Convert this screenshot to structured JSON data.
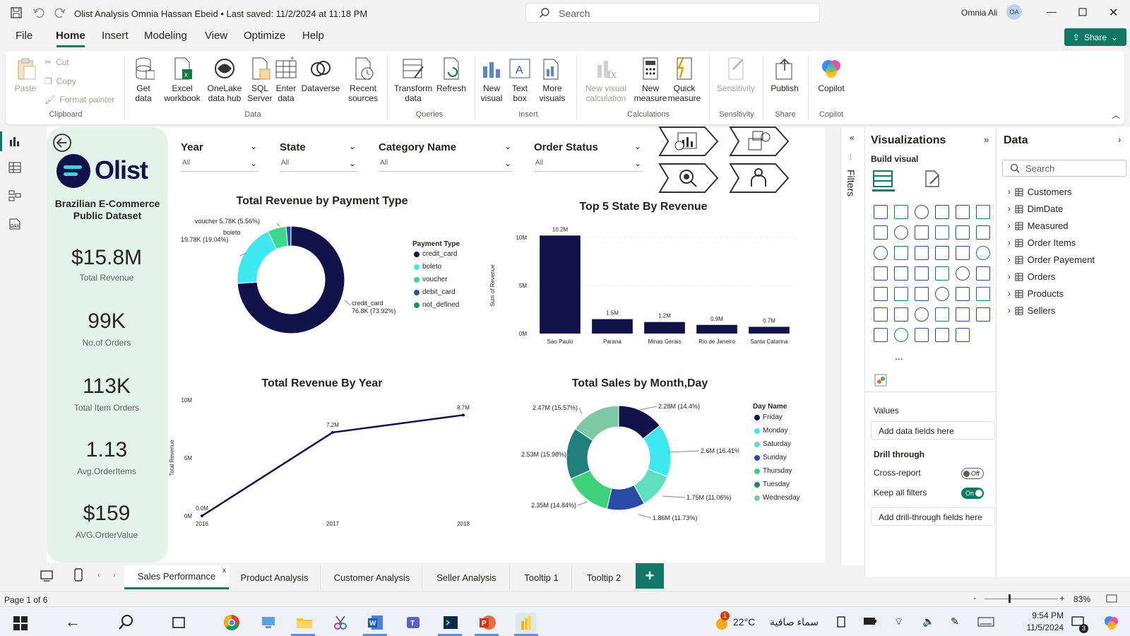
{
  "window": {
    "title": "Olist Analysis Omnia Hassan Ebeid • Last saved: 11/2/2024 at 11:18 PM",
    "search_placeholder": "Search",
    "user_name": "Omnia Ali",
    "user_initials": "OA"
  },
  "menu": [
    "File",
    "Home",
    "Insert",
    "Modeling",
    "View",
    "Optimize",
    "Help"
  ],
  "share_label": "Share",
  "ribbon": {
    "clipboard": {
      "paste": "Paste",
      "cut": "Cut",
      "copy": "Copy",
      "format_painter": "Format painter",
      "group": "Clipboard"
    },
    "data": {
      "get_data": "Get data",
      "excel": "Excel workbook",
      "onelake": "OneLake data hub",
      "sql": "SQL Server",
      "enter": "Enter data",
      "dataverse": "Dataverse",
      "recent": "Recent sources",
      "group": "Data"
    },
    "queries": {
      "transform": "Transform data",
      "refresh": "Refresh",
      "group": "Queries"
    },
    "insert": {
      "new_visual": "New visual",
      "text_box": "Text box",
      "more_visuals": "More visuals",
      "group": "Insert"
    },
    "calculations": {
      "new_visual_calc": "New visual calculation",
      "new_measure": "New measure",
      "quick_measure": "Quick measure",
      "group": "Calculations"
    },
    "sensitivity": {
      "label": "Sensitivity",
      "group": "Sensitivity"
    },
    "share": {
      "publish": "Publish",
      "group": "Share"
    },
    "copilot": {
      "label": "Copilot",
      "group": "Copilot"
    }
  },
  "report": {
    "brand": "Olist",
    "subtitle": "Brazilian E-Commerce Public Dataset",
    "kpis": [
      {
        "value": "$15.8M",
        "label": "Total Revenue"
      },
      {
        "value": "99K",
        "label": "No.of Orders"
      },
      {
        "value": "113K",
        "label": "Total Item Orders"
      },
      {
        "value": "1.13",
        "label": "Avg.OrderItems"
      },
      {
        "value": "$159",
        "label": "AVG.OrderValue"
      }
    ],
    "slicers": [
      {
        "title": "Year",
        "value": "All"
      },
      {
        "title": "State",
        "value": "All"
      },
      {
        "title": "Category Name",
        "value": "All"
      },
      {
        "title": "Order Status",
        "value": "All"
      }
    ]
  },
  "chart_data": [
    {
      "type": "pie",
      "title": "Total Revenue by Payment Type",
      "legend_title": "Payment Type",
      "categories": [
        "credit_card",
        "boleto",
        "voucher",
        "debit_card",
        "not_defined"
      ],
      "values": [
        73.92,
        19.04,
        5.56,
        1.45,
        0.03
      ],
      "labels": [
        "credit_card\n76.8K (73.92%)",
        "boleto\n19.78K (19.04%)",
        "voucher 5.78K (5.56%)",
        "",
        ""
      ],
      "colors": [
        "#12124a",
        "#3de8f0",
        "#3bd88a",
        "#2d4fa8",
        "#1f8a6a"
      ]
    },
    {
      "type": "bar",
      "title": "Top 5 State By Revenue",
      "ylabel": "Sum of Revenue",
      "categories": [
        "Sao Paulo",
        "Parana",
        "Minas Gerais",
        "Rio de Janeiro",
        "Santa Catarina"
      ],
      "values": [
        10.2,
        1.5,
        1.2,
        0.9,
        0.7
      ],
      "data_labels": [
        "10.2M",
        "1.5M",
        "1.2M",
        "0.9M",
        "0.7M"
      ],
      "ylim": [
        0,
        10
      ],
      "yticks": [
        "0M",
        "5M",
        "10M"
      ]
    },
    {
      "type": "line",
      "title": "Total Revenue By Year",
      "ylabel": "Total Revenue",
      "x": [
        "2016",
        "2017",
        "2018"
      ],
      "values": [
        0.0,
        7.2,
        8.7
      ],
      "data_labels": [
        "0.0M",
        "7.2M",
        "8.7M"
      ],
      "ylim": [
        0,
        10
      ],
      "yticks": [
        "0M",
        "5M",
        "10M"
      ]
    },
    {
      "type": "pie",
      "title": "Total Sales by Month,Day",
      "legend_title": "Day Name",
      "categories": [
        "Friday",
        "Monday",
        "Saturday",
        "Sunday",
        "Thursday",
        "Tuesday",
        "Wednesday"
      ],
      "values": [
        14.4,
        16.41,
        11.06,
        11.73,
        14.84,
        15.98,
        15.57
      ],
      "labels": [
        "2.28M (14.4%)",
        "2.6M (16.41%)",
        "1.75M (11.06%)",
        "1.86M (11.73%)",
        "2.35M (14.84%)",
        "2.53M (15.98%)",
        "2.47M (15.57%)"
      ],
      "colors": [
        "#12124a",
        "#3de8f0",
        "#5ee0c0",
        "#2a4aa6",
        "#3bd27a",
        "#1f7f7a",
        "#7cc9a4"
      ]
    }
  ],
  "pages": [
    "Sales Performance",
    "Product Analysis",
    "Customer Analysis",
    "Seller Analysis",
    "Tooltip 1",
    "Tooltip 2"
  ],
  "page_indicator": "Page 1 of 6",
  "zoom": "83%",
  "filters_label": "Filters",
  "visualizations": {
    "title": "Visualizations",
    "build_visual": "Build visual",
    "values": "Values",
    "add_fields": "Add data fields here",
    "drill_through": "Drill through",
    "cross_report": "Cross-report",
    "cross_report_state": "Off",
    "keep_filters": "Keep all filters",
    "keep_filters_state": "On",
    "add_drill": "Add drill-through fields here",
    "more": "..."
  },
  "data_pane": {
    "title": "Data",
    "search_placeholder": "Search",
    "tables": [
      "Customers",
      "DimDate",
      "Measured",
      "Order Items",
      "Order Payement",
      "Orders",
      "Products",
      "Sellers"
    ]
  },
  "taskbar": {
    "weather": "22°C",
    "weather_text": "سماء صافية",
    "time": "9:54 PM",
    "date": "11/5/2024",
    "notif": "3"
  },
  "colors": {
    "accent": "#117865",
    "navy": "#12124a",
    "cyan": "#3de8f0",
    "green": "#3bd88a",
    "panel": "#e3f3ec"
  }
}
